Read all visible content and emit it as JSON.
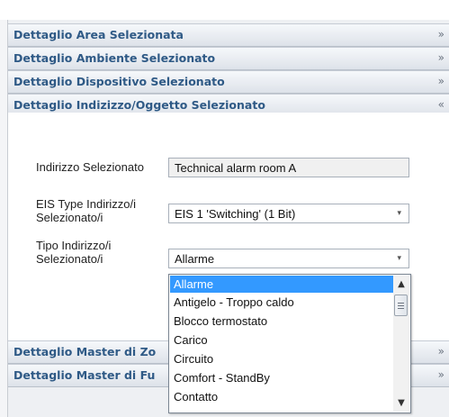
{
  "panels": [
    {
      "title": "Dettaglio Area Selezionata",
      "expanded": false
    },
    {
      "title": "Dettaglio Ambiente Selezionato",
      "expanded": false
    },
    {
      "title": "Dettaglio Dispositivo Selezionato",
      "expanded": false
    },
    {
      "title": "Dettaglio Indizizzo/Oggetto Selezionato",
      "expanded": true
    },
    {
      "title": "Dettaglio Master di Zo",
      "expanded": false
    },
    {
      "title": "Dettaglio Master di Fu",
      "expanded": false
    }
  ],
  "chevron_collapsed": "»",
  "chevron_expanded": "«",
  "form": {
    "address_label": "Indirizzo Selezionato",
    "address_value": "Technical alarm room A",
    "eis_label_line1": "EIS Type Indirizzo/i",
    "eis_label_line2": "Selezionato/i",
    "eis_value": "EIS 1 'Switching' (1 Bit)",
    "type_label_line1": "Tipo Indirizzo/i",
    "type_label_line2": "Selezionato/i",
    "type_value": "Allarme"
  },
  "dropdown": {
    "options": [
      "Allarme",
      "Antigelo - Troppo caldo",
      "Blocco termostato",
      "Carico",
      "Circuito",
      "Comfort - StandBy",
      "Contatto"
    ],
    "selected_index": 0,
    "scroll_fraction": 0.0
  },
  "icons": {
    "select_arrow": "▾",
    "scroll_up": "▲",
    "scroll_down": "▼"
  },
  "colors": {
    "header_text": "#2f5a86",
    "selection": "#3399ff"
  }
}
